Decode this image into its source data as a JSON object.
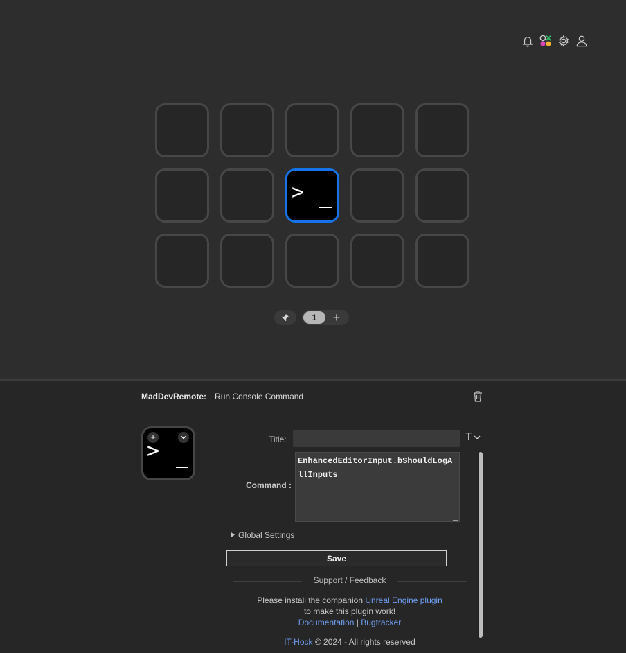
{
  "top_icons": [
    "bell-icon",
    "plugin-store-icon",
    "gear-icon",
    "user-icon"
  ],
  "grid": {
    "rows": 3,
    "cols": 5,
    "selected_key": {
      "row": 2,
      "col": 3,
      "icon": "terminal-icon",
      "glyph_prompt": ">",
      "glyph_cursor": "_"
    }
  },
  "pages": {
    "pin_icon": "pin-icon",
    "current": "1",
    "add_label": "+"
  },
  "panel": {
    "plugin_name": "MadDevRemote:",
    "action_name": "Run Console Command",
    "delete_icon": "trash-icon",
    "preview": {
      "plus": "+",
      "chevron": "⌄",
      "prompt": ">",
      "cursor": "_"
    },
    "title_label": "Title:",
    "title_value": "",
    "title_toggle": "T",
    "command_label": "Command :",
    "command_value": "EnhancedEditorInput.bShouldLogAllInputs",
    "global_settings": "Global Settings",
    "save_label": "Save",
    "support_heading": "Support / Feedback",
    "install_text_1": "Please install the companion",
    "install_link": "Unreal Engine plugin",
    "install_text_2": "to make this plugin work!",
    "doc_link": "Documentation",
    "separator": "|",
    "bug_link": "Bugtracker",
    "footer_link": "IT-Hock",
    "footer_text": "© 2024 - All rights reserved"
  },
  "colors": {
    "background": "#2d2d2d",
    "panel": "#262626",
    "accent_blue": "#1473e6",
    "link": "#6f9ef3"
  }
}
